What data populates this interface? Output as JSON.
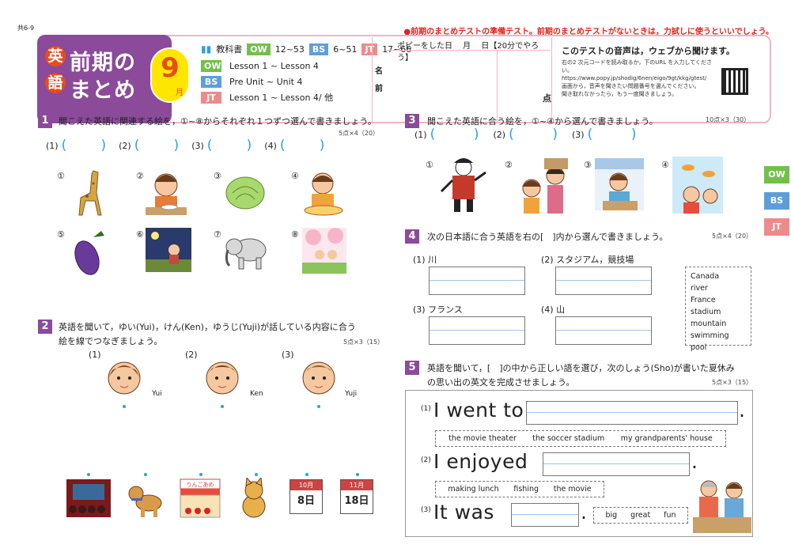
{
  "page_code": "共6-9",
  "notice": "●前期のまとめテストの準備テスト。前期のまとめテストがないときは，力試しに使うといいでしょう。",
  "title": {
    "eng_char": "英",
    "go_char": "語",
    "line1": "前期の",
    "line2": "まとめ",
    "month_num": "9",
    "month_unit": "月"
  },
  "textbook": {
    "label": "教科書",
    "items": [
      {
        "tag": "OW",
        "pages": "12~53"
      },
      {
        "tag": "BS",
        "pages": "6~51"
      },
      {
        "tag": "JT",
        "pages": "17~66"
      }
    ]
  },
  "lessons": [
    {
      "tag": "OW",
      "text": "Lesson 1 ~ Lesson 4"
    },
    {
      "tag": "BS",
      "text": "Pre Unit ~ Unit 4"
    },
    {
      "tag": "JT",
      "text": "Lesson 1 ~ Lesson 4/ 他"
    }
  ],
  "name_label": "名前",
  "popy_line": "ポピーをした日　 月　 日【20分でやろう】",
  "score_label": "点",
  "web": {
    "title": "このテストの音声は，ウェブから聞けます。",
    "line1": "右の2 次元コードを読み取るか，下のURL を入力してください。",
    "url": "https://www.popy.jp/shodig/6nen/eigo/9gt/kkg/gtest/",
    "line2": "画面から，音声を聞きたい問題番号を選んでください。",
    "line3": "聞き取れなかったら，もう一度聞きましょう。"
  },
  "side_tabs": [
    "OW",
    "BS",
    "JT"
  ],
  "side_colors": [
    "#72c04a",
    "#5d9ed9",
    "#ee8b8a"
  ],
  "q1": {
    "num": "1",
    "text": "聞こえた英語に関連する絵を，①~⑧からそれぞれ１つずつ選んで書きましょう。",
    "points": "5点×4（20）",
    "answers": [
      "(1)",
      "(2)",
      "(3)",
      "(4)"
    ],
    "choices": [
      "①",
      "②",
      "③",
      "④",
      "⑤",
      "⑥",
      "⑦",
      "⑧"
    ]
  },
  "q2": {
    "num": "2",
    "text1": "英語を聞いて，ゆい(Yui)，けん(Ken)，ゆうじ(Yuji)が話している内容に合う",
    "text2": "絵を線でつなぎましょう。",
    "points": "5点×3（15）",
    "people": [
      {
        "idx": "(1)",
        "name": "Yui"
      },
      {
        "idx": "(2)",
        "name": "Ken"
      },
      {
        "idx": "(3)",
        "name": "Yuji"
      }
    ],
    "sign": "りんごあめ",
    "cal1": {
      "month": "10月",
      "day": "8日"
    },
    "cal2": {
      "month": "11月",
      "day": "18日"
    }
  },
  "q3": {
    "num": "3",
    "text": "聞こえた英語に合う絵を，①~④から選んで書きましょう。",
    "points": "10点×3（30）",
    "answers": [
      "(1)",
      "(2)",
      "(3)"
    ],
    "choices": [
      "①",
      "②",
      "③",
      "④"
    ]
  },
  "q4": {
    "num": "4",
    "text": "次の日本語に合う英語を右の[　]内から選んで書きましょう。",
    "points": "5点×4（20）",
    "items": [
      {
        "idx": "(1)",
        "word": "川"
      },
      {
        "idx": "(2)",
        "word": "スタジアム，競技場"
      },
      {
        "idx": "(3)",
        "word": "フランス"
      },
      {
        "idx": "(4)",
        "word": "山"
      }
    ],
    "bank": [
      "Canada",
      "river",
      "France",
      "stadium",
      "mountain",
      "swimming pool"
    ]
  },
  "q5": {
    "num": "5",
    "text1": "英語を聞いて，[　]の中から正しい語を選び，次のしょう(Sho)が書いた夏休み",
    "text2": "の思い出の英文を完成させましょう。",
    "points": "5点×3（15）",
    "lines": [
      {
        "idx": "(1)",
        "text": "I went to",
        "end": "."
      },
      {
        "idx": "(2)",
        "text": "I enjoyed",
        "end": "."
      },
      {
        "idx": "(3)",
        "text": "It was",
        "end": "."
      }
    ],
    "opts1": [
      "the movie theater",
      "the soccer stadium",
      "my grandparents' house"
    ],
    "opts2": [
      "making lunch",
      "fishing",
      "the movie"
    ],
    "opts3": [
      "big",
      "great",
      "fun"
    ]
  }
}
